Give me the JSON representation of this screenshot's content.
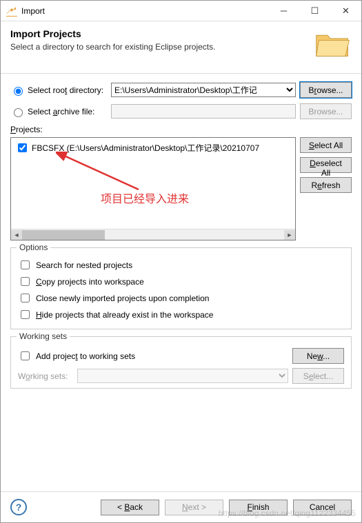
{
  "titlebar": {
    "title": "Import"
  },
  "header": {
    "title": "Import Projects",
    "subtitle": "Select a directory to search for existing Eclipse projects."
  },
  "source": {
    "root_label_pre": "Select roo",
    "root_label_u": "t",
    "root_label_post": " directory:",
    "root_value": "E:\\Users\\Administrator\\Desktop\\工作记",
    "archive_label_pre": "Select ",
    "archive_label_u": "a",
    "archive_label_post": "rchive file:",
    "archive_value": "",
    "browse1_pre": "B",
    "browse1_u": "r",
    "browse1_post": "owse...",
    "browse2": "Browse..."
  },
  "projects": {
    "label_u": "P",
    "label_post": "rojects:",
    "items": [
      {
        "checked": true,
        "text": "FBCSFX (E:\\Users\\Administrator\\Desktop\\工作记录\\20210707"
      }
    ],
    "select_all_u": "S",
    "select_all_post": "elect All",
    "deselect_all_u": "D",
    "deselect_all_post": "eselect All",
    "refresh_pre": "R",
    "refresh_u": "e",
    "refresh_post": "fresh"
  },
  "options": {
    "group": "Options",
    "nested": "Search for nested projects",
    "copy_u": "C",
    "copy_post": "opy projects into workspace",
    "close": "Close newly imported projects upon completion",
    "hide_pre": "",
    "hide_u": "H",
    "hide_post": "ide projects that already exist in the workspace"
  },
  "working_sets": {
    "group": "Working sets",
    "add_pre": "Add projec",
    "add_u": "t",
    "add_post": " to working sets",
    "new_pre": "Ne",
    "new_u": "w",
    "new_post": "...",
    "label_pre": "W",
    "label_u": "o",
    "label_post": "rking sets:",
    "select_pre": "S",
    "select_u": "e",
    "select_post": "lect..."
  },
  "footer": {
    "back_pre": "< ",
    "back_u": "B",
    "back_post": "ack",
    "next_u": "N",
    "next_post": "ext >",
    "finish_u": "F",
    "finish_post": "inish",
    "cancel": "Cancel"
  },
  "annotation": {
    "text": "项目已经导入进来"
  },
  "watermark": "https://blog.csdn.net/qing1122334455"
}
